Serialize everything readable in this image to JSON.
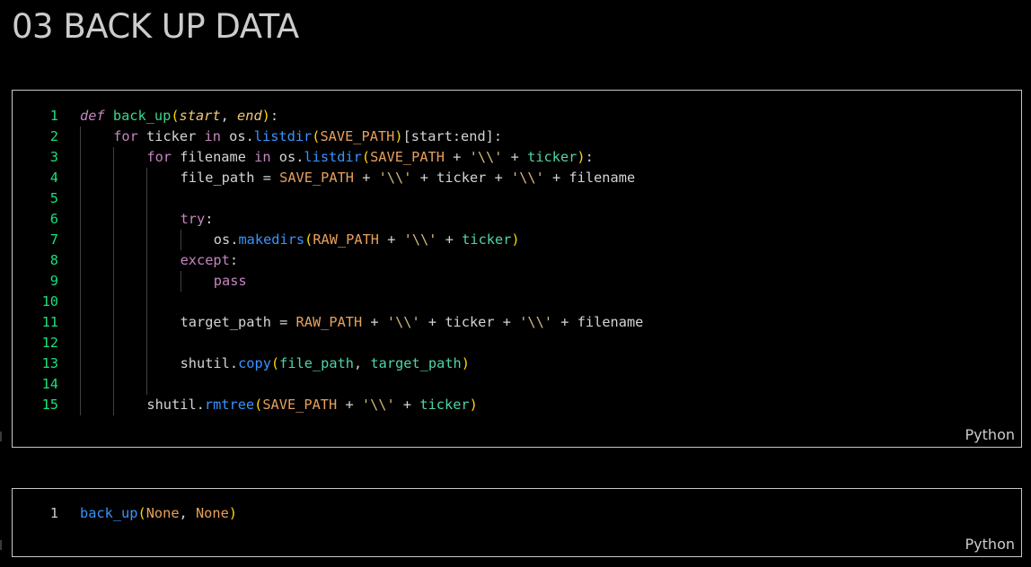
{
  "heading": "03 BACK UP DATA",
  "colors": {
    "background": "#000000",
    "cell_border": "#c7c7c7",
    "line_number": "#19e07a",
    "keyword": "#c586c0",
    "function": "#3bd68a",
    "method": "#3794ff",
    "constant": "#e8a05c"
  },
  "cells": [
    {
      "language": "Python",
      "lines": [
        {
          "number": "1",
          "indent": 0,
          "tokens": [
            {
              "t": "def",
              "c": "def"
            },
            {
              "t": " ",
              "c": "op"
            },
            {
              "t": "back_up",
              "c": "fn"
            },
            {
              "t": "(",
              "c": "paren"
            },
            {
              "t": "start",
              "c": "param"
            },
            {
              "t": ", ",
              "c": "op"
            },
            {
              "t": "end",
              "c": "param"
            },
            {
              "t": ")",
              "c": "paren"
            },
            {
              "t": ":",
              "c": "op"
            }
          ]
        },
        {
          "number": "2",
          "indent": 1,
          "tokens": [
            {
              "t": "for",
              "c": "kw"
            },
            {
              "t": " ticker ",
              "c": "var"
            },
            {
              "t": "in",
              "c": "kw"
            },
            {
              "t": " os.",
              "c": "mod"
            },
            {
              "t": "listdir",
              "c": "call"
            },
            {
              "t": "(",
              "c": "paren"
            },
            {
              "t": "SAVE_PATH",
              "c": "const"
            },
            {
              "t": ")",
              "c": "paren"
            },
            {
              "t": "[start:end]:",
              "c": "brack"
            }
          ]
        },
        {
          "number": "3",
          "indent": 2,
          "tokens": [
            {
              "t": "for",
              "c": "kw"
            },
            {
              "t": " filename ",
              "c": "var"
            },
            {
              "t": "in",
              "c": "kw"
            },
            {
              "t": " os.",
              "c": "mod"
            },
            {
              "t": "listdir",
              "c": "call"
            },
            {
              "t": "(",
              "c": "paren"
            },
            {
              "t": "SAVE_PATH",
              "c": "const"
            },
            {
              "t": " + ",
              "c": "op"
            },
            {
              "t": "'\\\\'",
              "c": "str"
            },
            {
              "t": " + ",
              "c": "op"
            },
            {
              "t": "ticker",
              "c": "arg"
            },
            {
              "t": ")",
              "c": "paren"
            },
            {
              "t": ":",
              "c": "op"
            }
          ]
        },
        {
          "number": "4",
          "indent": 3,
          "tokens": [
            {
              "t": "file_path = ",
              "c": "var"
            },
            {
              "t": "SAVE_PATH",
              "c": "const"
            },
            {
              "t": " + ",
              "c": "op"
            },
            {
              "t": "'\\\\'",
              "c": "str"
            },
            {
              "t": " + ticker + ",
              "c": "var"
            },
            {
              "t": "'\\\\'",
              "c": "str"
            },
            {
              "t": " + filename",
              "c": "var"
            }
          ]
        },
        {
          "number": "5",
          "indent": 3,
          "tokens": []
        },
        {
          "number": "6",
          "indent": 3,
          "tokens": [
            {
              "t": "try",
              "c": "kw"
            },
            {
              "t": ":",
              "c": "op"
            }
          ]
        },
        {
          "number": "7",
          "indent": 4,
          "tokens": [
            {
              "t": "os.",
              "c": "mod"
            },
            {
              "t": "makedirs",
              "c": "call"
            },
            {
              "t": "(",
              "c": "paren"
            },
            {
              "t": "RAW_PATH",
              "c": "const"
            },
            {
              "t": " + ",
              "c": "op"
            },
            {
              "t": "'\\\\'",
              "c": "str"
            },
            {
              "t": " + ",
              "c": "op"
            },
            {
              "t": "ticker",
              "c": "arg"
            },
            {
              "t": ")",
              "c": "paren"
            }
          ]
        },
        {
          "number": "8",
          "indent": 3,
          "tokens": [
            {
              "t": "except",
              "c": "kw"
            },
            {
              "t": ":",
              "c": "op"
            }
          ]
        },
        {
          "number": "9",
          "indent": 4,
          "tokens": [
            {
              "t": "pass",
              "c": "kw"
            }
          ]
        },
        {
          "number": "10",
          "indent": 3,
          "tokens": []
        },
        {
          "number": "11",
          "indent": 3,
          "tokens": [
            {
              "t": "target_path = ",
              "c": "var"
            },
            {
              "t": "RAW_PATH",
              "c": "const"
            },
            {
              "t": " + ",
              "c": "op"
            },
            {
              "t": "'\\\\'",
              "c": "str"
            },
            {
              "t": " + ticker + ",
              "c": "var"
            },
            {
              "t": "'\\\\'",
              "c": "str"
            },
            {
              "t": " + filename",
              "c": "var"
            }
          ]
        },
        {
          "number": "12",
          "indent": 3,
          "tokens": []
        },
        {
          "number": "13",
          "indent": 3,
          "tokens": [
            {
              "t": "shutil.",
              "c": "mod"
            },
            {
              "t": "copy",
              "c": "call"
            },
            {
              "t": "(",
              "c": "paren"
            },
            {
              "t": "file_path",
              "c": "arg"
            },
            {
              "t": ", ",
              "c": "op"
            },
            {
              "t": "target_path",
              "c": "arg"
            },
            {
              "t": ")",
              "c": "paren"
            }
          ]
        },
        {
          "number": "14",
          "indent": 3,
          "tokens": []
        },
        {
          "number": "15",
          "indent": 2,
          "tokens": [
            {
              "t": "shutil.",
              "c": "mod"
            },
            {
              "t": "rmtree",
              "c": "call"
            },
            {
              "t": "(",
              "c": "paren"
            },
            {
              "t": "SAVE_PATH",
              "c": "const"
            },
            {
              "t": " + ",
              "c": "op"
            },
            {
              "t": "'\\\\'",
              "c": "str"
            },
            {
              "t": " + ",
              "c": "op"
            },
            {
              "t": "ticker",
              "c": "arg"
            },
            {
              "t": ")",
              "c": "paren"
            }
          ]
        }
      ]
    },
    {
      "language": "Python",
      "lines": [
        {
          "number": "1",
          "indent": 0,
          "tokens": [
            {
              "t": "back_up",
              "c": "call"
            },
            {
              "t": "(",
              "c": "paren"
            },
            {
              "t": "None",
              "c": "none"
            },
            {
              "t": ", ",
              "c": "op"
            },
            {
              "t": "None",
              "c": "none"
            },
            {
              "t": ")",
              "c": "paren"
            }
          ]
        }
      ]
    }
  ]
}
